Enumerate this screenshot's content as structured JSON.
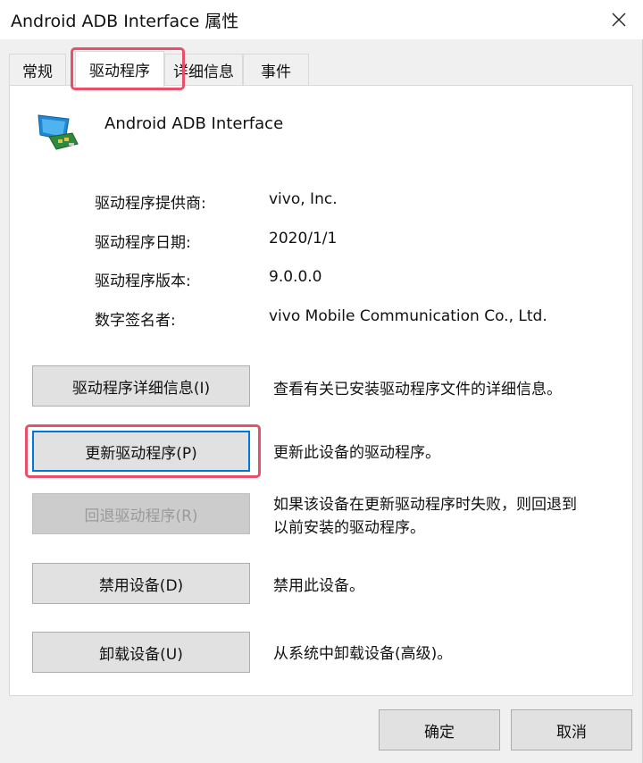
{
  "window": {
    "title": "Android ADB Interface 属性",
    "close_icon": "close-icon"
  },
  "tabs": [
    {
      "label": "常规",
      "active": false
    },
    {
      "label": "驱动程序",
      "active": true
    },
    {
      "label": "详细信息",
      "active": false
    },
    {
      "label": "事件",
      "active": false
    }
  ],
  "device": {
    "icon": "network-adapter-icon",
    "name": "Android ADB Interface"
  },
  "driver_info": [
    {
      "label": "驱动程序提供商:",
      "value": "vivo, Inc."
    },
    {
      "label": "驱动程序日期:",
      "value": "2020/1/1"
    },
    {
      "label": "驱动程序版本:",
      "value": "9.0.0.0"
    },
    {
      "label": "数字签名者:",
      "value": "vivo Mobile Communication Co., Ltd."
    }
  ],
  "actions": [
    {
      "label": "驱动程序详细信息(I)",
      "description": "查看有关已安装驱动程序文件的详细信息。",
      "enabled": true
    },
    {
      "label": "更新驱动程序(P)",
      "description": "更新此设备的驱动程序。",
      "enabled": true
    },
    {
      "label": "回退驱动程序(R)",
      "description_line1": "如果该设备在更新驱动程序时失败，则回退到",
      "description_line2": "以前安装的驱动程序。",
      "enabled": false
    },
    {
      "label": "禁用设备(D)",
      "description": "禁用此设备。",
      "enabled": true
    },
    {
      "label": "卸载设备(U)",
      "description": "从系统中卸载设备(高级)。",
      "enabled": true
    }
  ],
  "footer": {
    "ok_label": "确定",
    "cancel_label": "取消"
  },
  "colors": {
    "highlight": "#e8506a",
    "focus": "#0078d7"
  }
}
